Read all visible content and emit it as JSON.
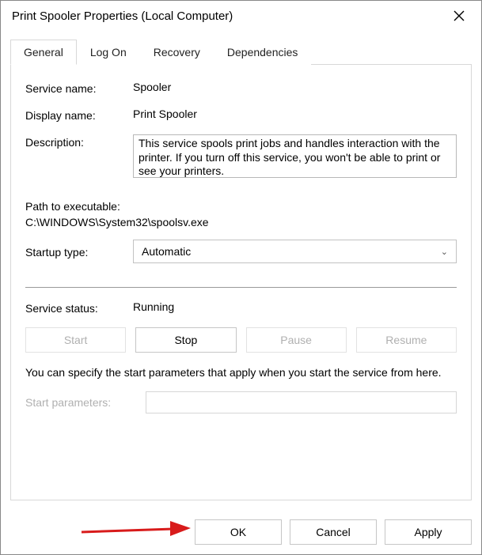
{
  "window": {
    "title": "Print Spooler Properties (Local Computer)"
  },
  "tabs": {
    "general": "General",
    "logon": "Log On",
    "recovery": "Recovery",
    "dependencies": "Dependencies"
  },
  "fields": {
    "service_name_label": "Service name:",
    "service_name_value": "Spooler",
    "display_name_label": "Display name:",
    "display_name_value": "Print Spooler",
    "description_label": "Description:",
    "description_value": "This service spools print jobs and handles interaction with the printer.  If you turn off this service, you won't be able to print or see your printers.",
    "path_label": "Path to executable:",
    "path_value": "C:\\WINDOWS\\System32\\spoolsv.exe",
    "startup_type_label": "Startup type:",
    "startup_type_value": "Automatic",
    "service_status_label": "Service status:",
    "service_status_value": "Running",
    "hint_text": "You can specify the start parameters that apply when you start the service from here.",
    "start_parameters_label": "Start parameters:"
  },
  "buttons": {
    "start": "Start",
    "stop": "Stop",
    "pause": "Pause",
    "resume": "Resume",
    "ok": "OK",
    "cancel": "Cancel",
    "apply": "Apply"
  }
}
